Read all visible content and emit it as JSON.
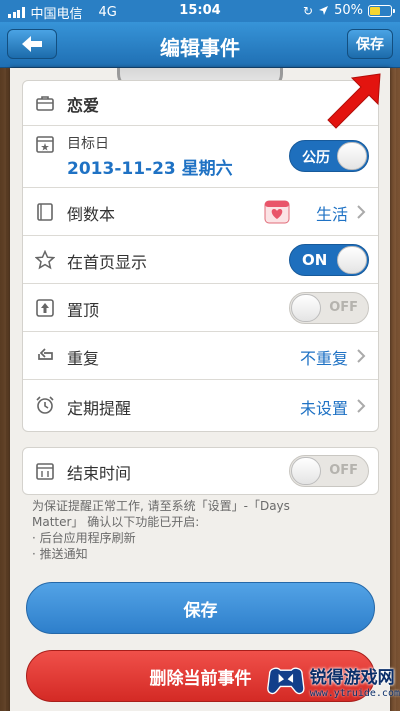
{
  "status_bar": {
    "carrier": "中国电信",
    "network": "4G",
    "time": "15:04",
    "battery_percent": "50%",
    "battery_level": 0.5
  },
  "nav": {
    "title": "编辑事件",
    "save_label": "保存"
  },
  "category_row": {
    "label": "恋爱",
    "icon": "briefcase-icon"
  },
  "target_date_row": {
    "label": "目标日",
    "date": "2013-11-23 星期六",
    "toggle_label": "公历",
    "toggle_on": true,
    "icon": "calendar-star-icon"
  },
  "book_row": {
    "label": "倒数本",
    "value": "生活",
    "icon": "book-icon"
  },
  "homepage_row": {
    "label": "在首页显示",
    "toggle_label": "ON",
    "toggle_on": true,
    "icon": "star-icon"
  },
  "pin_row": {
    "label": "置顶",
    "toggle_label": "OFF",
    "toggle_on": false,
    "icon": "pin-top-icon"
  },
  "repeat_row": {
    "label": "重复",
    "value": "不重复",
    "icon": "repeat-icon"
  },
  "reminder_row": {
    "label": "定期提醒",
    "value": "未设置",
    "icon": "alarm-icon"
  },
  "end_time_row": {
    "label": "结束时间",
    "toggle_label": "OFF",
    "toggle_on": false,
    "icon": "calendar-end-icon"
  },
  "note": {
    "line1": "为保证提醒正常工作, 请至系统「设置」-「Days",
    "line2": "Matter」 确认以下功能已开启:",
    "line3": "· 后台应用程序刷新",
    "line4": "· 推送通知"
  },
  "buttons": {
    "save": "保存",
    "delete": "删除当前事件"
  },
  "watermark": {
    "title": "锐得游戏网",
    "url": "www.ytruide.com"
  },
  "colors": {
    "accent": "#1f72c4",
    "nav_blue": "#2a7fc4",
    "delete_red": "#e0332e",
    "pointer_red": "#e3140f"
  }
}
